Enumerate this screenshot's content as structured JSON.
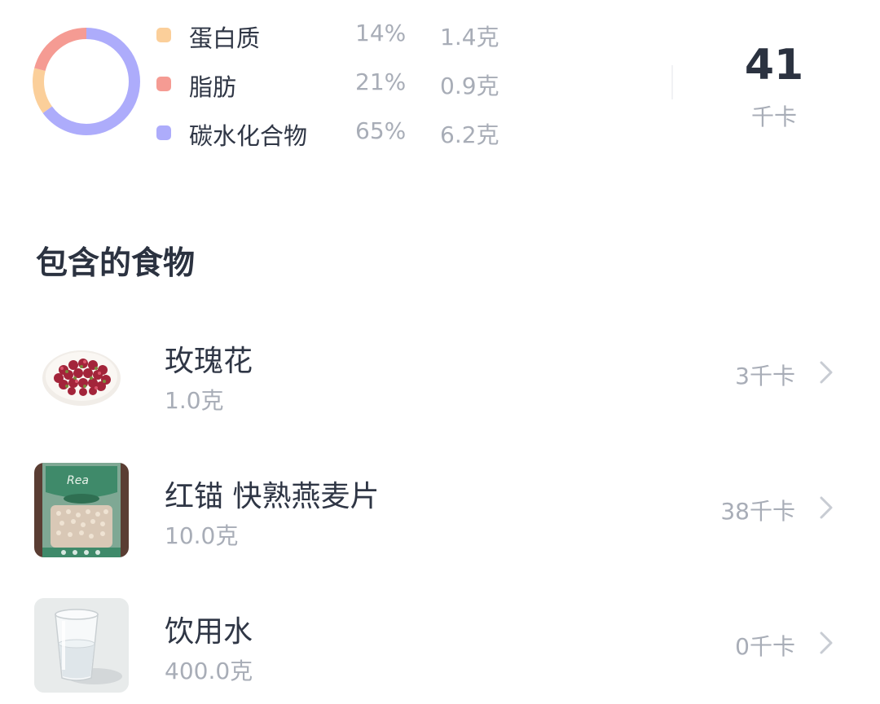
{
  "nutrition": {
    "macros": [
      {
        "name": "蛋白质",
        "percent": "14%",
        "amount": "1.4克",
        "color": "#fbcf9a",
        "share": 0.14
      },
      {
        "name": "脂肪",
        "percent": "21%",
        "amount": "0.9克",
        "color": "#f59b93",
        "share": 0.21
      },
      {
        "name": "碳水化合物",
        "percent": "65%",
        "amount": "6.2克",
        "color": "#adacfb",
        "share": 0.65
      }
    ],
    "total_value": "41",
    "total_unit": "千卡"
  },
  "foods_section": {
    "title": "包含的食物",
    "items": [
      {
        "name": "玫瑰花",
        "weight": "1.0克",
        "kcal": "3千卡",
        "thumb_icon": "rose-tea-photo"
      },
      {
        "name": "红锚 快熟燕麦片",
        "weight": "10.0克",
        "kcal": "38千卡",
        "thumb_icon": "oats-package-photo"
      },
      {
        "name": "饮用水",
        "weight": "400.0克",
        "kcal": "0千卡",
        "thumb_icon": "water-glass-photo"
      }
    ]
  }
}
